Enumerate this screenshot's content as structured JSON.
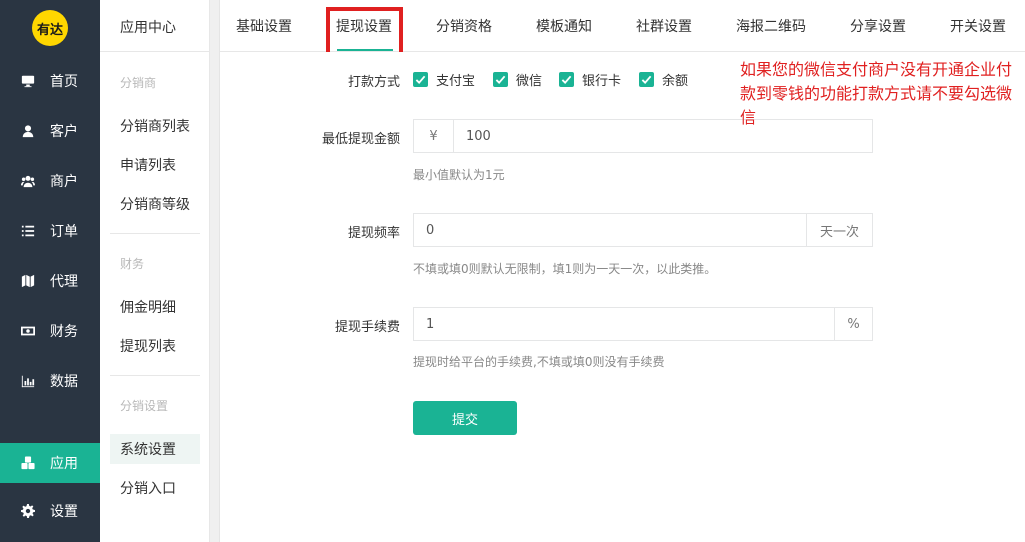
{
  "app": {
    "logo_text": "有达"
  },
  "nav": {
    "items": [
      {
        "label": "首页",
        "icon": "desktop-icon"
      },
      {
        "label": "客户",
        "icon": "user-icon"
      },
      {
        "label": "商户",
        "icon": "users-icon"
      },
      {
        "label": "订单",
        "icon": "list-icon"
      },
      {
        "label": "代理",
        "icon": "map-icon"
      },
      {
        "label": "财务",
        "icon": "money-icon"
      },
      {
        "label": "数据",
        "icon": "bar-chart-icon"
      },
      {
        "label": "应用",
        "icon": "cubes-icon"
      },
      {
        "label": "设置",
        "icon": "gear-icon"
      }
    ],
    "active": "应用"
  },
  "subnav": {
    "title": "应用中心",
    "groups": [
      {
        "label": "分销商",
        "items": [
          "分销商列表",
          "申请列表",
          "分销商等级"
        ]
      },
      {
        "label": "财务",
        "items": [
          "佣金明细",
          "提现列表"
        ]
      },
      {
        "label": "分销设置",
        "items": [
          "系统设置",
          "分销入口"
        ]
      }
    ],
    "active": "系统设置"
  },
  "tabs": [
    "基础设置",
    "提现设置",
    "分销资格",
    "模板通知",
    "社群设置",
    "海报二维码",
    "分享设置",
    "开关设置"
  ],
  "active_tab": "提现设置",
  "form": {
    "payment_label": "打款方式",
    "payment_options": [
      "支付宝",
      "微信",
      "银行卡",
      "余额"
    ],
    "min_label": "最低提现金额",
    "min_prefix": "¥",
    "min_value": "100",
    "min_help": "最小值默认为1元",
    "freq_label": "提现频率",
    "freq_value": "0",
    "freq_suffix": "天一次",
    "freq_help": "不填或填0则默认无限制，填1则为一天一次，以此类推。",
    "fee_label": "提现手续费",
    "fee_value": "1",
    "fee_suffix": "%",
    "fee_help": "提现时给平台的手续费,不填或填0则没有手续费",
    "submit_label": "提交"
  },
  "annotation": "如果您的微信支付商户没有开通企业付款到零钱的功能打款方式请不要勾选微信",
  "colors": {
    "sidebar": "#2a3542",
    "accent": "#1ab394",
    "note": "#e02020"
  }
}
